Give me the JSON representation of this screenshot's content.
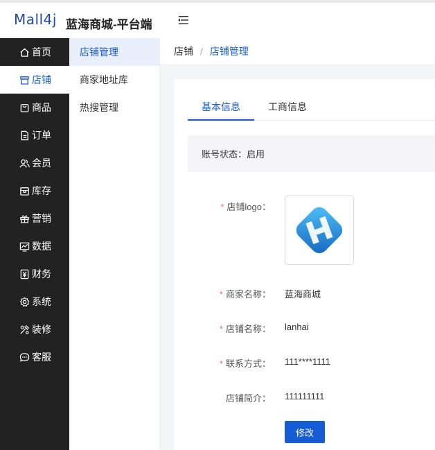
{
  "header": {
    "logo_text": "Mall4j",
    "app_title": "蓝海商城-平台端"
  },
  "sidebar": {
    "items": [
      {
        "label": "首页",
        "icon": "home-icon"
      },
      {
        "label": "店铺",
        "icon": "shop-icon",
        "active": true
      },
      {
        "label": "商品",
        "icon": "goods-icon"
      },
      {
        "label": "订单",
        "icon": "order-icon"
      },
      {
        "label": "会员",
        "icon": "member-icon"
      },
      {
        "label": "库存",
        "icon": "stock-icon"
      },
      {
        "label": "营销",
        "icon": "gift-icon"
      },
      {
        "label": "数据",
        "icon": "chart-icon"
      },
      {
        "label": "财务",
        "icon": "finance-icon"
      },
      {
        "label": "系统",
        "icon": "gear-icon"
      },
      {
        "label": "装修",
        "icon": "decorate-icon"
      },
      {
        "label": "客服",
        "icon": "chat-icon"
      }
    ]
  },
  "submenu": {
    "items": [
      {
        "label": "店铺管理",
        "active": true
      },
      {
        "label": "商家地址库"
      },
      {
        "label": "热搜管理"
      }
    ]
  },
  "breadcrumb": {
    "root": "店铺",
    "sep": "/",
    "current": "店铺管理"
  },
  "tabs": [
    {
      "label": "基本信息",
      "active": true
    },
    {
      "label": "工商信息"
    }
  ],
  "status": {
    "label": "账号状态：",
    "value": "启用"
  },
  "form": {
    "logo_label": "店铺logo：",
    "merchant_name_label": "商家名称：",
    "merchant_name": "蓝海商城",
    "shop_name_label": "店铺名称：",
    "shop_name": "lanhai",
    "contact_label": "联系方式：",
    "contact": "111****1111",
    "intro_label": "店铺简介：",
    "intro": "111111111",
    "required_mark": "*"
  },
  "edit_button": "修改",
  "colors": {
    "accent": "#155bd4",
    "sidebar_bg": "#222222",
    "required": "#f56c6c"
  }
}
